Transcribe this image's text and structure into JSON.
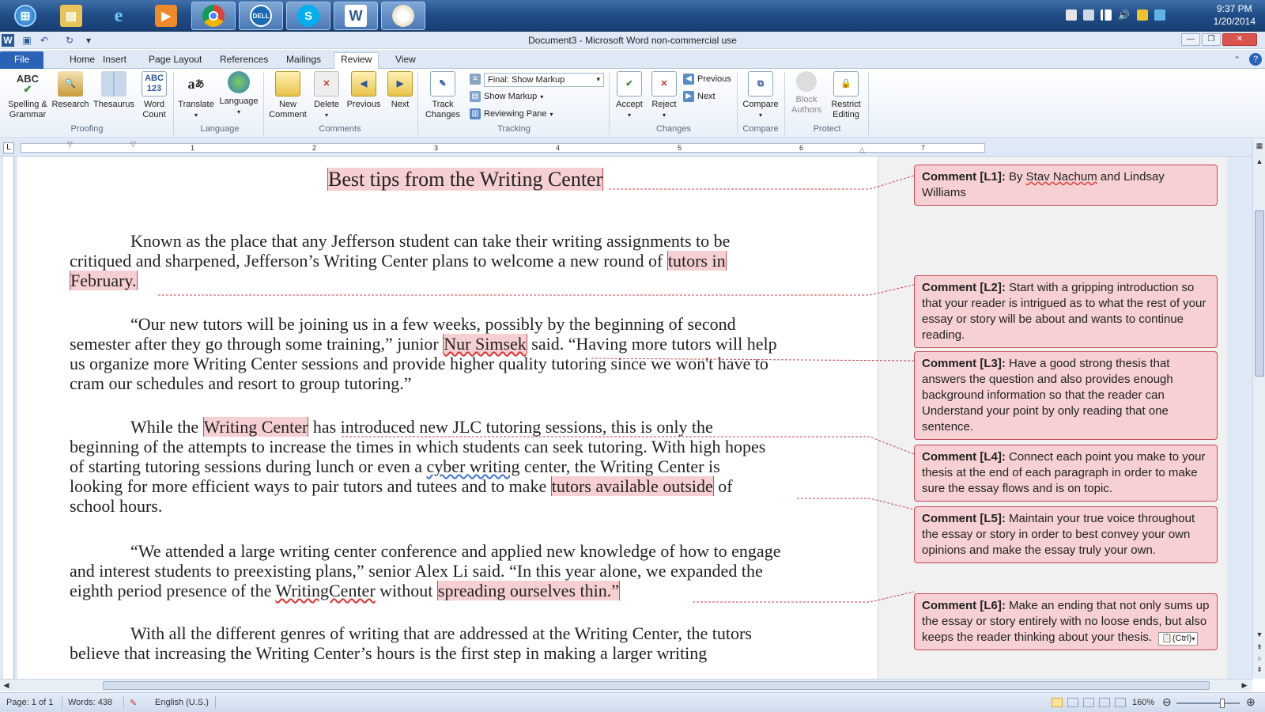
{
  "window": {
    "title": "Document3 - Microsoft Word non-commercial use"
  },
  "taskbar": {
    "apps": [
      "start-orb",
      "explorer",
      "internet-explorer",
      "media-player",
      "chrome",
      "dell",
      "skype",
      "word",
      "paint"
    ],
    "word_label": "W",
    "dell_label": "DELL",
    "clock_time": "9:37 PM",
    "clock_date": "1/20/2014"
  },
  "tabs": [
    {
      "label": "File"
    },
    {
      "label": "Home"
    },
    {
      "label": "Insert"
    },
    {
      "label": "Page Layout"
    },
    {
      "label": "References"
    },
    {
      "label": "Mailings"
    },
    {
      "label": "Review"
    },
    {
      "label": "View"
    }
  ],
  "ribbon": {
    "spelling": "Spelling &",
    "spelling2": "Grammar",
    "spelling_icon": "ABC",
    "research": "Research",
    "thesaurus": "Thesaurus",
    "wordcount": "Word",
    "wordcount2": "Count",
    "wordcount_icon": "ABC 123",
    "translate": "Translate",
    "language": "Language",
    "newcomment": "New",
    "newcomment2": "Comment",
    "delete": "Delete",
    "previous": "Previous",
    "next": "Next",
    "track": "Track",
    "track2": "Changes",
    "markup_select": "Final: Show Markup",
    "show_markup": "Show Markup",
    "reviewing_pane": "Reviewing Pane",
    "accept": "Accept",
    "reject": "Reject",
    "chg_previous": "Previous",
    "chg_next": "Next",
    "compare": "Compare",
    "block": "Block",
    "block2": "Authors",
    "restrict": "Restrict",
    "restrict2": "Editing",
    "groups": {
      "proofing": "Proofing",
      "language": "Language",
      "comments": "Comments",
      "tracking": "Tracking",
      "changes": "Changes",
      "compare": "Compare",
      "protect": "Protect"
    }
  },
  "ruler": {
    "numbers": [
      "1",
      "2",
      "3",
      "4",
      "5",
      "6",
      "7"
    ]
  },
  "document": {
    "title": "Best tips from the Writing Center",
    "p1": {
      "a": "Known as the place that any Jefferson student can take their writing assignments to be",
      "b": "critiqued and sharpened, Jefferson’s Writing Center plans to welcome a new round of",
      "c_hl": "tutors in",
      "d_hl": "February."
    },
    "p2": {
      "a": "“Our new tutors will be joining us in a few weeks, possibly by the beginning of second",
      "b1": "semester after they go through some training,” junior",
      "b_hl": "Nur Simsek",
      "b2": "said. “Having more tutors will help",
      "c": "us organize more Writing Center sessions and provide higher quality tutoring since we won't have to",
      "d": "cram our schedules and resort to group tutoring.”"
    },
    "p3": {
      "a1": "While the",
      "a_hl": "Writing Center",
      "a2": "has introduced new JLC tutoring sessions, this is only the",
      "b": "beginning of the attempts to increase the times in which students can seek tutoring. With high hopes",
      "c1": "of starting tutoring sessions during lunch or even a",
      "c_u": "cyber writing",
      "c2": "center, the Writing Center is",
      "d1": "looking for more efficient ways to pair tutors and tutees and to make",
      "d_hl": "tutors available outside",
      "d2": "of",
      "e": "school hours."
    },
    "p4": {
      "a": "“We attended a large writing center conference and applied new knowledge of how to engage",
      "b": "and interest students to preexisting plans,” senior Alex Li said. “In this year alone, we expanded the",
      "c1": "eighth period presence of the",
      "c_u": "WritingCenter",
      "c2": "without",
      "c_hl": "spreading ourselves thin.”"
    },
    "p5": {
      "a": "With all the different genres of writing that are addressed at the Writing Center, the tutors",
      "b": "believe that increasing the Writing Center’s hours is the first step in making a larger writing"
    }
  },
  "comments": [
    {
      "label": "Comment [L1]:",
      "text_a": " By ",
      "text_u1": "Stav Nachum",
      "text_b": " and Lindsay Williams"
    },
    {
      "label": "Comment [L2]:",
      "text": " Start with a gripping introduction so that your reader is intrigued as to what the rest of your essay or story will be about and wants to continue reading."
    },
    {
      "label": "Comment [L3]:",
      "text": " Have a good strong thesis that answers the question and also provides enough background information so that the reader can Understand your point by only reading that one sentence."
    },
    {
      "label": "Comment [L4]:",
      "text": " Connect each point you make to your thesis at the end of each paragraph in order to make sure the essay flows and is on topic."
    },
    {
      "label": "Comment [L5]:",
      "text": " Maintain your true voice throughout the essay or story in order to best convey your own opinions and make the essay truly your own."
    },
    {
      "label": "Comment [L6]:",
      "text": " Make an ending that not only sums up the essay or story entirely with no loose ends, but also keeps the reader thinking about your thesis.",
      "paste_label": "(Ctrl)"
    }
  ],
  "statusbar": {
    "page": "Page: 1 of 1",
    "words": "Words: 438",
    "language": "English (U.S.)",
    "zoom": "160%",
    "zoom_fraction": 0.72
  },
  "colors": {
    "comment_fill": "#f6d0d3",
    "comment_border": "#c44a55",
    "file_tab": "#2a62b5"
  }
}
